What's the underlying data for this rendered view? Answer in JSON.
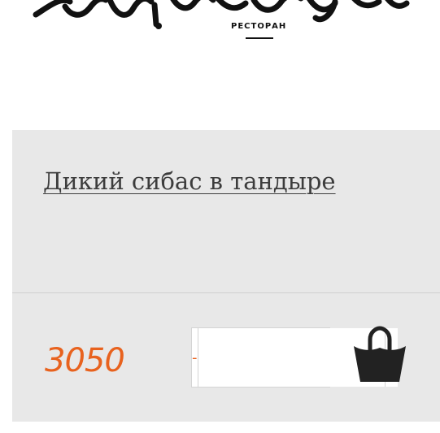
{
  "logo": {
    "caption": "РЕСТОРАН"
  },
  "product": {
    "title": "Дикий сибас в тандыре",
    "price": "3050"
  },
  "stepper": {
    "minus_label": "-",
    "plus_label": "+",
    "value": ""
  },
  "colors": {
    "accent": "#e8621e",
    "card_bg": "#e8e8e8",
    "title_text": "#3c3c3c",
    "icon": "#222222"
  },
  "icons": {
    "cart": "shopping-bag-icon"
  }
}
